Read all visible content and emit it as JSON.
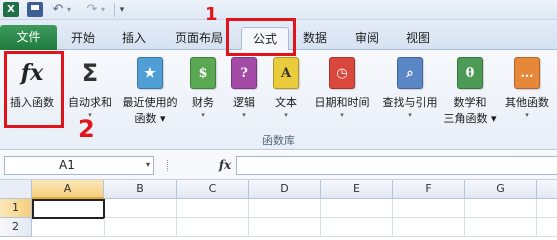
{
  "qat": {
    "app_logo": "X",
    "save_icon": "save-icon",
    "undo_icon": "↶",
    "redo_icon": "↷",
    "drop_glyph": "▾",
    "customize_glyph": "▾"
  },
  "tabs": {
    "file": "文件",
    "home": "开始",
    "insert": "插入",
    "layout": "页面布局",
    "formula": "公式",
    "data": "数据",
    "review": "审阅",
    "view": "视图"
  },
  "ribbon": {
    "group_label": "函数库",
    "commands": [
      {
        "label": "插入函数",
        "label2": "",
        "glyph": "fx",
        "color": ""
      },
      {
        "label": "自动求和",
        "label2": "▾",
        "glyph": "Σ",
        "color": ""
      },
      {
        "label": "最近使用的",
        "label2": "函数 ▾",
        "glyph": "★",
        "color": "#4f9fd6"
      },
      {
        "label": "财务",
        "label2": "▾",
        "glyph": "$",
        "color": "#5aa852"
      },
      {
        "label": "逻辑",
        "label2": "▾",
        "glyph": "?",
        "color": "#a44ba8"
      },
      {
        "label": "文本",
        "label2": "▾",
        "glyph": "A",
        "color": "#e9cb3c"
      },
      {
        "label": "日期和时间",
        "label2": "▾",
        "glyph": "◷",
        "color": "#d9473d"
      },
      {
        "label": "查找与引用",
        "label2": "▾",
        "glyph": "⌕",
        "color": "#5a86c6"
      },
      {
        "label": "数学和",
        "label2": "三角函数 ▾",
        "glyph": "θ",
        "color": "#4c9a56"
      },
      {
        "label": "其他函数",
        "label2": "▾",
        "glyph": "…",
        "color": "#e6873a"
      }
    ]
  },
  "annotations": {
    "step1": "1",
    "step2": "2",
    "color": "#e0141a"
  },
  "formula_bar": {
    "name_box": "A1",
    "fx": "fx",
    "formula": ""
  },
  "grid": {
    "columns": [
      "A",
      "B",
      "C",
      "D",
      "E",
      "F",
      "G"
    ],
    "rows": [
      "1",
      "2"
    ],
    "active_cell": "A1"
  }
}
